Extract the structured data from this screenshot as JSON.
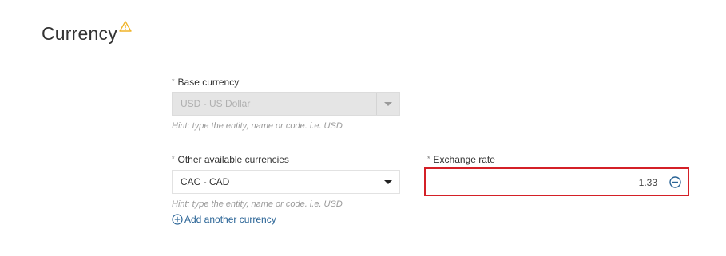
{
  "section": {
    "title": "Currency",
    "warning_icon": "warning-icon"
  },
  "base_currency": {
    "required_marker": "*",
    "label": "Base currency",
    "value": "USD - US Dollar",
    "hint": "Hint: type the entity, name or code. i.e. USD",
    "disabled": true
  },
  "other_currencies": {
    "required_marker": "*",
    "label": "Other available currencies",
    "value": "CAC - CAD",
    "hint": "Hint: type the entity, name or code. i.e. USD"
  },
  "exchange_rate": {
    "required_marker": "*",
    "label": "Exchange rate",
    "value": "1.33",
    "remove_icon": "minus-circle-icon",
    "highlight_color": "#d42027"
  },
  "add_currency": {
    "icon": "plus-circle-icon",
    "label": "Add another currency"
  },
  "colors": {
    "link": "#2a6496",
    "warning": "#f0b429"
  }
}
